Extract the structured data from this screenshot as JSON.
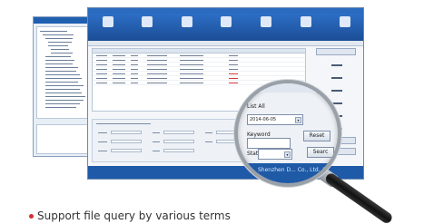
{
  "caption": "Support file query by various terms",
  "magnifier": {
    "list_all": "List All",
    "date_value": "2014-06-05",
    "keyword_label": "Keyword",
    "state_label": "State",
    "reset_button": "Reset",
    "search_button": "Searc",
    "footer_text": "Shenzhen D... Co., Ltd. All R"
  },
  "colors": {
    "toolbar": "#2d6fc6",
    "accent_red": "#d23030"
  },
  "icons": [
    "dropdown-arrow-icon",
    "magnifier-icon"
  ]
}
